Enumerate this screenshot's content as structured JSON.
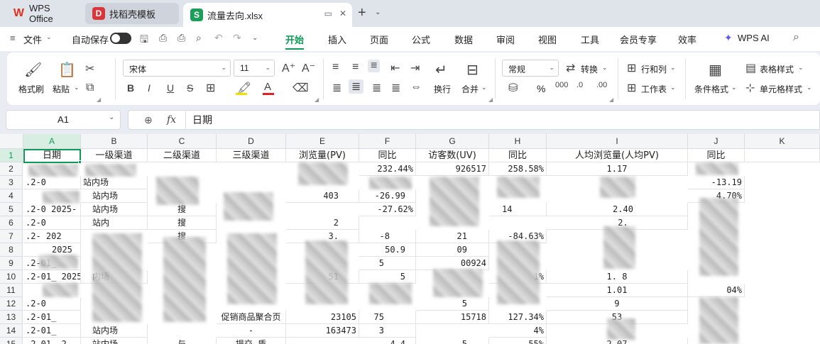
{
  "tabs": [
    {
      "label": "WPS Office",
      "icon": "wps-logo-icon"
    },
    {
      "label": "找稻壳模板",
      "icon": "docer-icon"
    },
    {
      "label": "流量去向.xlsx",
      "icon": "sheet-icon",
      "logo_text": "S"
    }
  ],
  "menu": {
    "file": "文件",
    "autosave": "自动保存",
    "items": [
      "开始",
      "插入",
      "页面",
      "公式",
      "数据",
      "审阅",
      "视图",
      "工具",
      "会员专享",
      "效率"
    ],
    "active": "开始",
    "wps_ai": "WPS AI"
  },
  "ribbon": {
    "format_painter": "格式刷",
    "paste": "粘贴",
    "font_name": "宋体",
    "font_size": "11",
    "wrap": "换行",
    "merge": "合并",
    "number_format": "常规",
    "convert": "转换",
    "row_col": "行和列",
    "worksheet": "工作表",
    "cond_format": "条件格式",
    "table_style": "表格样式",
    "cell_style": "单元格样式",
    "percent": "%",
    "bold": "B",
    "italic": "I",
    "underline": "U",
    "strike": "S"
  },
  "formula_bar": {
    "cell_ref": "A1",
    "fx": "fx",
    "value": "日期"
  },
  "columns": [
    "A",
    "B",
    "C",
    "D",
    "E",
    "F",
    "G",
    "H",
    "I",
    "J",
    "K"
  ],
  "rows": [
    "1",
    "2",
    "3",
    "4",
    "5",
    "6",
    "7",
    "8",
    "9",
    "10",
    "11",
    "12",
    "13",
    "14",
    "15"
  ],
  "header_row": [
    "日期",
    "一级渠道",
    "二级渠道",
    "三级渠道",
    "浏览量(PV)",
    "同比",
    "访客数(UV)",
    "同比",
    "人均浏览量(人均PV)",
    "同比"
  ],
  "visible_cells": {
    "F2": "232.44%",
    "G2": "926517",
    "H2": "258.58%",
    "I2": "1.17",
    "A3": ".2-0",
    "B3": "站内场",
    "J3": "-13.19",
    "B4": "站内场",
    "E4": "403",
    "F4": "-26.99",
    "J4": "4.70%",
    "A5": ".2-0 2025-",
    "B5": "站内场",
    "C5": "搜",
    "F5": "-27.62%",
    "H5": "14",
    "I5": "2.40",
    "A6": ".2-0",
    "B6": "站内",
    "C6": "搜",
    "E6": "2",
    "I6": "2.",
    "A7": ".2- 202",
    "C7": "搜",
    "E7": "3.",
    "F7": "-8",
    "G7": "21",
    "H7": "-84.63%",
    "A8": "2025",
    "F8": "50.9",
    "G8": "09",
    "A9": ".2-01_",
    "F9": "5",
    "G9": "00924",
    "A10": ".2-01_ 2025-",
    "B10": "内场",
    "E10": "51",
    "F10": "5",
    "H10": "1%",
    "I10": "1. 8",
    "I11": "1.01",
    "J11": "04%",
    "A12": ".2-0",
    "G12": "5",
    "I12": "9",
    "A13": ".2-01_",
    "D13": "促销商品聚合页",
    "E13": "23105",
    "F13": "75",
    "G13": "15718",
    "H13": "127.34%",
    "I13": "53",
    "A14": ".2-01_",
    "B14": "站内场",
    "D14": "-",
    "E14": "163473",
    "F14": "3",
    "H14": "4%",
    "A15": ".2-01_ 2",
    "B15": "站内场",
    "C15": "与",
    "D15": "提交 质",
    "F15": "-4.4",
    "G15": "5",
    "H15": ".55%",
    "I15": "2.07"
  },
  "colors": {
    "accent": "#0e9a57",
    "wps_red": "#e0301e",
    "sheet_green": "#1e9c5a"
  }
}
